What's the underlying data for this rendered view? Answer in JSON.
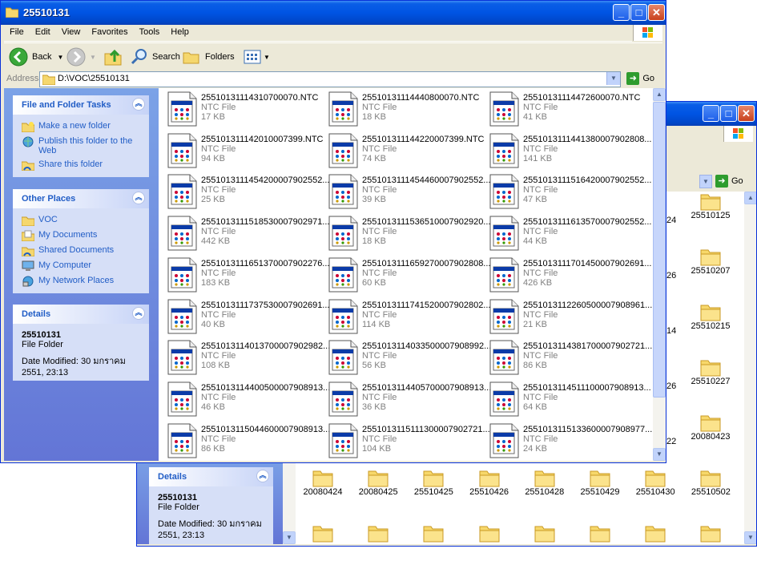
{
  "back_window": {
    "details": {
      "heading": "Details",
      "name": "25510131",
      "type": "File Folder",
      "modified": "Date Modified: 30 มกราคม 2551, 23:13"
    },
    "partial_labels": [
      "24",
      "26",
      "14",
      "26",
      "22"
    ],
    "right_folders": [
      "25510125",
      "25510207",
      "25510215",
      "25510227",
      "20080423"
    ],
    "bottom_folders": [
      "20080424",
      "20080425",
      "25510425",
      "25510426",
      "25510428",
      "25510429",
      "25510430",
      "25510502"
    ],
    "go_label": "Go"
  },
  "front_window": {
    "title": "25510131",
    "menu": [
      "File",
      "Edit",
      "View",
      "Favorites",
      "Tools",
      "Help"
    ],
    "toolbar": {
      "back": "Back",
      "search": "Search",
      "folders": "Folders"
    },
    "address": {
      "label": "Address",
      "path": "D:\\VOC\\25510131",
      "go": "Go"
    },
    "tasks": {
      "heading": "File and Folder Tasks",
      "items": [
        {
          "label": "Make a new folder",
          "icon": "new-folder-icon"
        },
        {
          "label": "Publish this folder to the Web",
          "icon": "publish-web-icon"
        },
        {
          "label": "Share this folder",
          "icon": "share-folder-icon"
        }
      ]
    },
    "places": {
      "heading": "Other Places",
      "items": [
        {
          "label": "VOC",
          "icon": "folder-icon"
        },
        {
          "label": "My Documents",
          "icon": "my-documents-icon"
        },
        {
          "label": "Shared Documents",
          "icon": "shared-documents-icon"
        },
        {
          "label": "My Computer",
          "icon": "my-computer-icon"
        },
        {
          "label": "My Network Places",
          "icon": "network-places-icon"
        }
      ]
    },
    "details": {
      "heading": "Details",
      "name": "25510131",
      "type": "File Folder",
      "modified": "Date Modified: 30 มกราคม 2551, 23:13"
    },
    "files": [
      {
        "name": "25510131114310700070.NTC",
        "type": "NTC File",
        "size": "17 KB"
      },
      {
        "name": "25510131114440800070.NTC",
        "type": "NTC File",
        "size": "18 KB"
      },
      {
        "name": "25510131114472600070.NTC",
        "type": "NTC File",
        "size": "41 KB"
      },
      {
        "name": "25510131114201000739​9.NTC",
        "type": "NTC File",
        "size": "94 KB"
      },
      {
        "name": "2551013111442200073​99.NTC",
        "type": "NTC File",
        "size": "74 KB"
      },
      {
        "name": "255101311144138000790​2808...",
        "type": "NTC File",
        "size": "141 KB"
      },
      {
        "name": "255101311145420000790​2552...",
        "type": "NTC File",
        "size": "25 KB"
      },
      {
        "name": "255101311145446000790​2552...",
        "type": "NTC File",
        "size": "39 KB"
      },
      {
        "name": "255101311151642000790​2552...",
        "type": "NTC File",
        "size": "47 KB"
      },
      {
        "name": "255101311151853000790​2971...",
        "type": "NTC File",
        "size": "442 KB"
      },
      {
        "name": "255101311153651000790​2920...",
        "type": "NTC File",
        "size": "18 KB"
      },
      {
        "name": "255101311161357000790​2552...",
        "type": "NTC File",
        "size": "44 KB"
      },
      {
        "name": "255101311165137000790​2276...",
        "type": "NTC File",
        "size": "183 KB"
      },
      {
        "name": "255101311165927000790​2808...",
        "type": "NTC File",
        "size": "60 KB"
      },
      {
        "name": "255101311170145000790​2691...",
        "type": "NTC File",
        "size": "426 KB"
      },
      {
        "name": "255101311173753000790​2691...",
        "type": "NTC File",
        "size": "40 KB"
      },
      {
        "name": "255101311174152000790​2802...",
        "type": "NTC File",
        "size": "114 KB"
      },
      {
        "name": "255101311226050000790​8961...",
        "type": "NTC File",
        "size": "21 KB"
      },
      {
        "name": "255101311401370000790​2982...",
        "type": "NTC File",
        "size": "108 KB"
      },
      {
        "name": "255101311403350000790​8992...",
        "type": "NTC File",
        "size": "56 KB"
      },
      {
        "name": "255101311438170000790​2721...",
        "type": "NTC File",
        "size": "86 KB"
      },
      {
        "name": "255101311440050000790​8913...",
        "type": "NTC File",
        "size": "46 KB"
      },
      {
        "name": "255101311440570000790​8913...",
        "type": "NTC File",
        "size": "36 KB"
      },
      {
        "name": "255101311451110000790​8913...",
        "type": "NTC File",
        "size": "64 KB"
      },
      {
        "name": "255101311504460000790​8913...",
        "type": "NTC File",
        "size": "86 KB"
      },
      {
        "name": "255101311511130000790​2721...",
        "type": "NTC File",
        "size": "104 KB"
      },
      {
        "name": "255101311513360000790​8977...",
        "type": "NTC File",
        "size": "24 KB"
      }
    ]
  }
}
